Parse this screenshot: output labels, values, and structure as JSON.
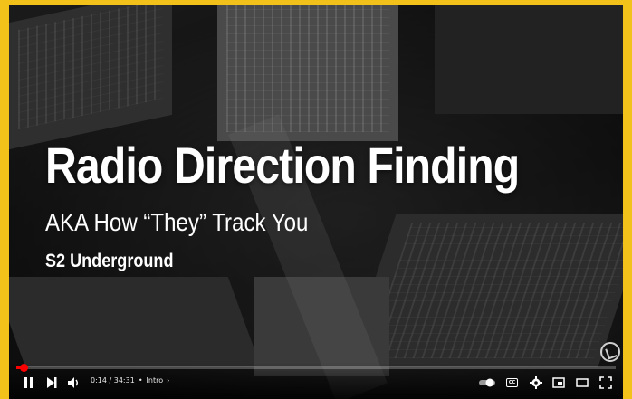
{
  "video": {
    "title": "Radio Direction Finding",
    "subtitle": "AKA How “They” Track You",
    "channel": "S2 Underground"
  },
  "player": {
    "progress_fraction": 0.012,
    "current_time": "0:14",
    "duration": "34:31",
    "time_display": "0:14 / 34:31",
    "chapter_label": "Intro",
    "chapter_separator": "•",
    "chapter_chevron": "›",
    "autoplay_on": true,
    "colors": {
      "accent": "#ff0000",
      "frame": "#f2c21a"
    }
  },
  "icons": {
    "play_pause": "pause-icon",
    "next": "next-icon",
    "volume": "volume-icon",
    "autoplay": "autoplay-toggle-icon",
    "captions": "captions-icon",
    "settings": "gear-icon",
    "miniplayer": "miniplayer-icon",
    "theater": "theater-mode-icon",
    "fullscreen": "fullscreen-icon"
  }
}
